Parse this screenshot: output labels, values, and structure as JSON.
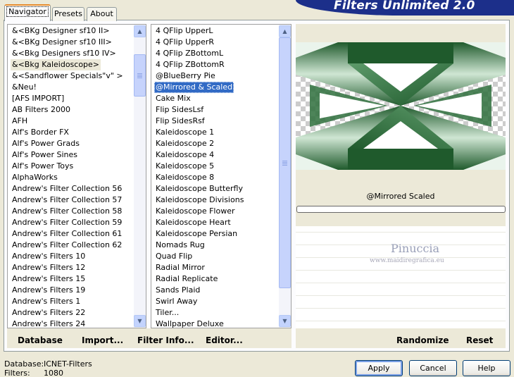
{
  "window": {
    "title": "Filters Unlimited 2.0"
  },
  "tabs": [
    {
      "label": "Navigator",
      "active": true
    },
    {
      "label": "Presets",
      "active": false
    },
    {
      "label": "About",
      "active": false
    }
  ],
  "categories": {
    "selected_index": 3,
    "items": [
      "&<BKg Designer sf10 II>",
      "&<BKg Designer sf10 III>",
      "&<Bkg Designers sf10 IV>",
      "&<Bkg Kaleidoscope>",
      "&<Sandflower Specials\"v\" >",
      "&Neu!",
      "[AFS IMPORT]",
      "AB Filters 2000",
      "AFH",
      "Alf's Border FX",
      "Alf's Power Grads",
      "Alf's Power Sines",
      "Alf's Power Toys",
      "AlphaWorks",
      "Andrew's Filter Collection 56",
      "Andrew's Filter Collection 57",
      "Andrew's Filter Collection 58",
      "Andrew's Filter Collection 59",
      "Andrew's Filter Collection 61",
      "Andrew's Filter Collection 62",
      "Andrew's Filters 10",
      "Andrew's Filters 12",
      "Andrew's Filters 15",
      "Andrew's Filters 19",
      "Andrew's Filters 1",
      "Andrew's Filters 22",
      "Andrew's Filters 24"
    ]
  },
  "filters": {
    "selected_index": 5,
    "items": [
      "4 QFlip UpperL",
      "4 QFlip UpperR",
      "4 QFlip ZBottomL",
      "4 QFlip ZBottomR",
      "@BlueBerry Pie",
      "@Mirrored & Scaled",
      "Cake Mix",
      "Flip SidesLsf",
      "Flip SidesRsf",
      "Kaleidoscope 1",
      "Kaleidoscope 2",
      "Kaleidoscope 4",
      "Kaleidoscope 5",
      "Kaleidoscope 8",
      "Kaleidoscope Butterfly",
      "Kaleidoscope Divisions",
      "Kaleidoscope Flower",
      "Kaleidoscope Heart",
      "Kaleidoscope Persian",
      "Nomads Rug",
      "Quad Flip",
      "Radial Mirror",
      "Radial Replicate",
      "Sands Plaid",
      "Swirl Away",
      "Tiler...",
      "Wallpaper Deluxe"
    ]
  },
  "preview": {
    "filter_name": "@Mirrored  Scaled",
    "watermark_name": "Pinuccia",
    "watermark_url": "www.maidiregrafica.eu",
    "colors": {
      "dark_green": "#1f5a2c",
      "mid_green": "#5d9a6a",
      "light_green": "#cfe6d3"
    }
  },
  "toolbar": {
    "database": "Database",
    "import": "Import...",
    "filter_info": "Filter Info...",
    "editor": "Editor...",
    "randomize": "Randomize",
    "reset": "Reset"
  },
  "dialog_buttons": {
    "apply": "Apply",
    "cancel": "Cancel",
    "help": "Help"
  },
  "status": {
    "database_label": "Database:",
    "database_value": "ICNET-Filters",
    "filters_label": "Filters:",
    "filters_value": "1080"
  }
}
